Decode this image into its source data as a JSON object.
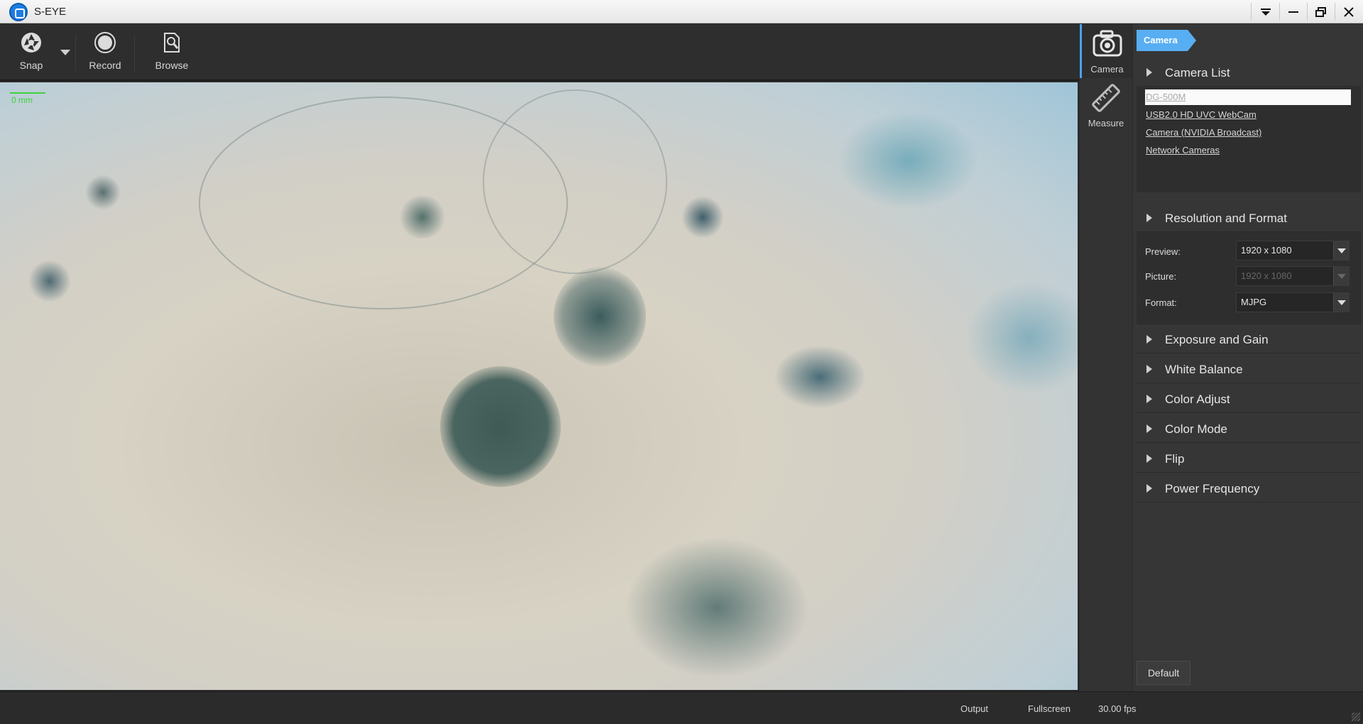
{
  "window": {
    "title": "S-EYE",
    "controls": [
      "dropdown-icon",
      "minimize-icon",
      "restore-icon",
      "close-icon"
    ]
  },
  "toolbar": {
    "snap_label": "Snap",
    "record_label": "Record",
    "browse_label": "Browse"
  },
  "viewport": {
    "scale_label": "0 mm",
    "scale_color": "#3dd33d"
  },
  "sidetabs": [
    {
      "label": "Camera",
      "icon": "camera-icon"
    },
    {
      "label": "Measure",
      "icon": "ruler-icon"
    }
  ],
  "panel": {
    "breadcrumb": "Camera",
    "accent_color": "#58aef2",
    "camera_list": {
      "title": "Camera List",
      "items": [
        "DG-500M",
        "USB2.0 HD UVC WebCam",
        "Camera (NVIDIA Broadcast)",
        "Network Cameras"
      ]
    },
    "resolution": {
      "title": "Resolution and Format",
      "preview_label": "Preview:",
      "preview_value": "1920 x 1080",
      "picture_label": "Picture:",
      "picture_value": "1920 x 1080",
      "format_label": "Format:",
      "format_value": "MJPG"
    },
    "sections": [
      "Exposure and Gain",
      "White Balance",
      "Color Adjust",
      "Color Mode",
      "Flip",
      "Power Frequency"
    ],
    "default_label": "Default"
  },
  "statusbar": {
    "output_label": "Output",
    "fullscreen_label": "Fullscreen",
    "fps": "30.00 fps"
  }
}
